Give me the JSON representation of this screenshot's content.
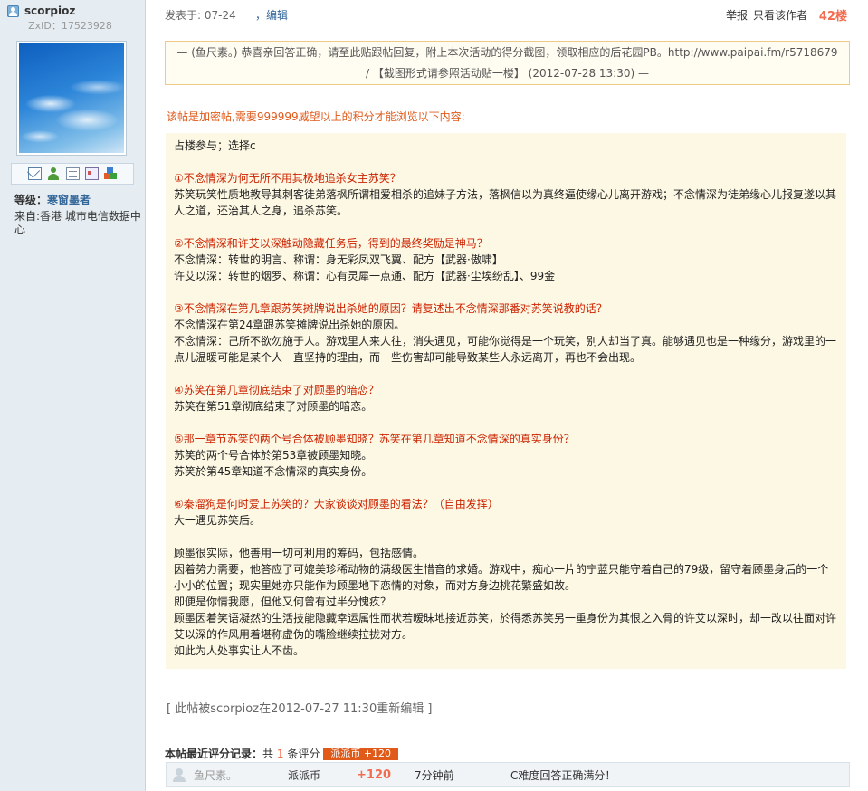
{
  "user": {
    "username": "scorpioz",
    "zxid": "ZxID：17523928",
    "level_label": "等级：",
    "level_value": "寒窗墨者",
    "from": "来自:香港 城市电信数据中心"
  },
  "post_header": {
    "posted": "发表于: 07-24",
    "edit": "编辑",
    "report": "举报",
    "author_only": "只看该作者",
    "floor": "42楼"
  },
  "quote": {
    "line1": "— (鱼尺素。) 恭喜亲回答正确，请至此贴跟帖回复，附上本次活动的得分截图，领取相应的后花园PB。http://www.paipai.fm/r5718679",
    "line2": "/ 【截图形式请参照活动贴一楼】 (2012-07-28 13:30) —"
  },
  "lock_notice": "该帖是加密帖,需要999999威望以上的积分才能浏览以下内容:",
  "content": [
    {
      "t": "占楼参与；选择c",
      "q": false
    },
    {
      "t": "",
      "q": false
    },
    {
      "t": "①不念情深为何无所不用其极地追杀女主苏笑？",
      "q": true
    },
    {
      "t": "苏笑玩笑性质地教导其刺客徒弟落枫所谓相爱相杀的追妹子方法，落枫信以为真终逼使缘心儿离开游戏；不念情深为徒弟缘心儿报复遂以其人之道，还治其人之身，追杀苏笑。",
      "q": false
    },
    {
      "t": "",
      "q": false
    },
    {
      "t": "②不念情深和许艾以深触动隐藏任务后，得到的最终奖励是神马？",
      "q": true
    },
    {
      "t": "不念情深：转世的明言、称谓：身无彩凤双飞翼、配方【武器·傲啸】",
      "q": false
    },
    {
      "t": "许艾以深：转世的烟罗、称谓：心有灵犀一点通、配方【武器·尘埃纷乱】、99金",
      "q": false
    },
    {
      "t": "",
      "q": false
    },
    {
      "t": "③不念情深在第几章跟苏笑摊牌说出杀她的原因？请复述出不念情深那番对苏笑说教的话？",
      "q": true
    },
    {
      "t": "不念情深在第24章跟苏笑摊牌说出杀她的原因。",
      "q": false
    },
    {
      "t": "不念情深：己所不欲勿施于人。游戏里人来人往，消失遇见，可能你觉得是一个玩笑，别人却当了真。能够遇见也是一种缘分，游戏里的一点儿温暖可能是某个人一直坚持的理由，而一些伤害却可能导致某些人永远离开，再也不会出现。",
      "q": false
    },
    {
      "t": "",
      "q": false
    },
    {
      "t": "④苏笑在第几章彻底结束了对顾墨的暗恋？",
      "q": true
    },
    {
      "t": "苏笑在第51章彻底结束了对顾墨的暗恋。",
      "q": false
    },
    {
      "t": "",
      "q": false
    },
    {
      "t": "⑤那一章节苏笑的两个号合体被顾墨知晓？苏笑在第几章知道不念情深的真实身份？",
      "q": true
    },
    {
      "t": "苏笑的两个号合体於第53章被顾墨知晓。",
      "q": false
    },
    {
      "t": "苏笑於第45章知道不念情深的真实身份。",
      "q": false
    },
    {
      "t": "",
      "q": false
    },
    {
      "t": "⑥秦溜狗是何时爱上苏笑的？大家谈谈对顾墨的看法？（自由发挥）",
      "q": true
    },
    {
      "t": "大一遇见苏笑后。",
      "q": false
    },
    {
      "t": "",
      "q": false
    },
    {
      "t": "顾墨很实际，他善用一切可利用的筹码，包括感情。",
      "q": false
    },
    {
      "t": "因着势力需要，他答应了可媲美珍稀动物的满级医生惜音的求婚。游戏中，痴心一片的宁蓝只能守着自己的79级，留守着顾墨身后的一个小小的位置；现实里她亦只能作为顾墨地下恋情的对象，而对方身边桃花繁盛如故。",
      "q": false
    },
    {
      "t": "即便是你情我愿，但他又何曾有过半分愧疚？",
      "q": false
    },
    {
      "t": "顾墨因着笑语凝然的生活技能隐藏幸运属性而状若暧昧地接近苏笑，於得悉苏笑另一重身份为其恨之入骨的许艾以深时，却一改以往面对许艾以深的作风用着堪称虚伪的嘴脸继续拉拢对方。",
      "q": false
    },
    {
      "t": "如此为人处事实让人不齿。",
      "q": false
    }
  ],
  "re_edit": "[ 此帖被scorpioz在2012-07-27 11:30重新编辑 ]",
  "rating": {
    "title": "本帖最近评分记录：",
    "count_prefix": "共",
    "count": "1",
    "count_suffix": "条评分",
    "badge": "派派币 +120",
    "row": {
      "user": "鱼尺素。",
      "field": "派派币",
      "score": "+120",
      "time": "7分钟前",
      "reason": "C难度回答正确满分！"
    }
  }
}
